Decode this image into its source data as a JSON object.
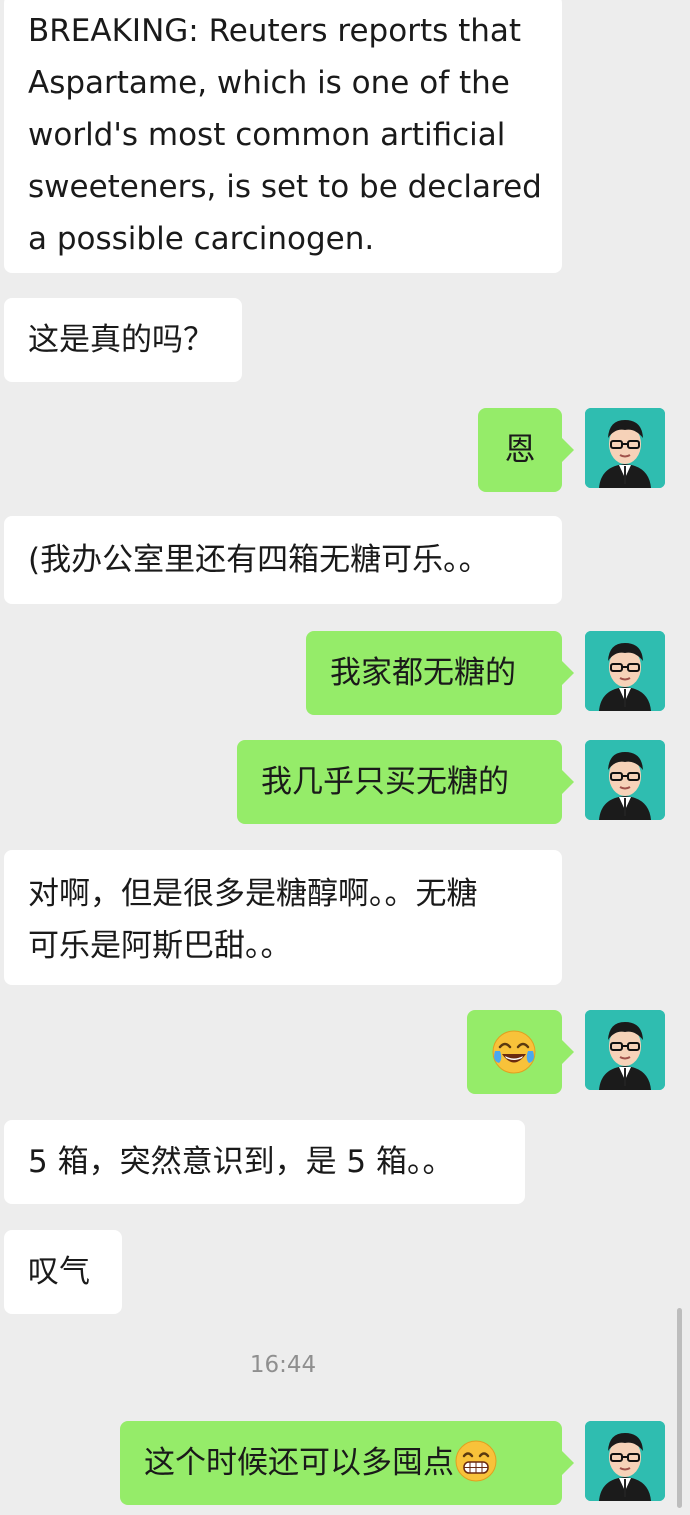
{
  "messages": [
    {
      "side": "left",
      "lines": [
        "BREAKING: Reuters reports that",
        "Aspartame, which is one of the",
        "world's most common artificial",
        "sweeteners, is set to be declared",
        "a possible carcinogen."
      ]
    },
    {
      "side": "left",
      "text": "这是真的吗？"
    },
    {
      "side": "right",
      "text": "恩"
    },
    {
      "side": "left",
      "text": "(我办公室里还有四箱无糖可乐。。"
    },
    {
      "side": "right",
      "text": "我家都无糖的"
    },
    {
      "side": "right",
      "text": "我几乎只买无糖的"
    },
    {
      "side": "left",
      "lines": [
        "对啊，但是很多是糖醇啊。。无糖",
        "可乐是阿斯巴甜。。"
      ]
    },
    {
      "side": "right",
      "emoji": "tears-of-joy-emoji"
    },
    {
      "side": "left",
      "text": "5 箱，突然意识到，是 5 箱。。"
    },
    {
      "side": "left",
      "text": "叹气"
    },
    {
      "side": "right",
      "text": "这个时候还可以多囤点",
      "emoji": "grinning-emoji"
    }
  ],
  "timestamp": "16:44",
  "colors": {
    "background": "#ededed",
    "left_bubble": "#ffffff",
    "right_bubble": "#95ec69",
    "avatar_bg": "#2fbdb0"
  }
}
